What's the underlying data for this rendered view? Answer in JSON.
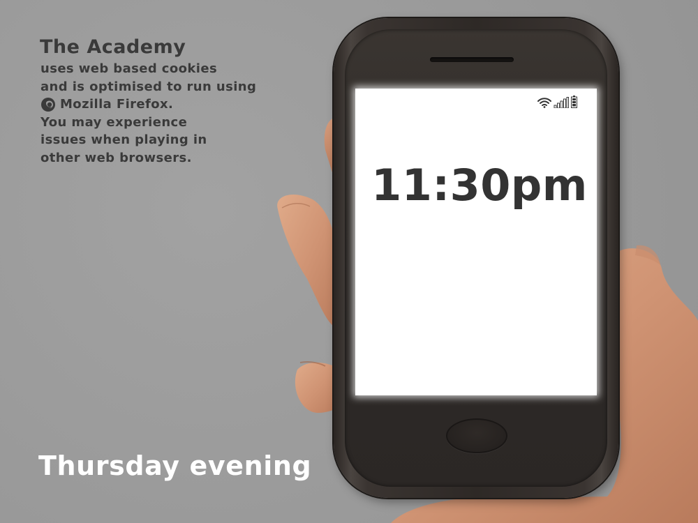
{
  "notice": {
    "title": "The Academy",
    "line1": "uses web based cookies",
    "line2": "and is optimised to run using",
    "firefox_text": "Mozilla Firefox.",
    "line3": "You may experience",
    "line4": "issues when playing in",
    "line5": "other web browsers."
  },
  "caption": "Thursday evening",
  "phone": {
    "clock": "11:30pm",
    "status_icons": [
      "wifi-icon",
      "signal-icon",
      "battery-icon"
    ]
  },
  "colors": {
    "background": "#9a9a9a",
    "notice_text": "#3a3a3a",
    "caption_text": "#ffffff",
    "clock_text": "#333333",
    "phone_body": "#2e2926",
    "screen": "#ffffff"
  }
}
